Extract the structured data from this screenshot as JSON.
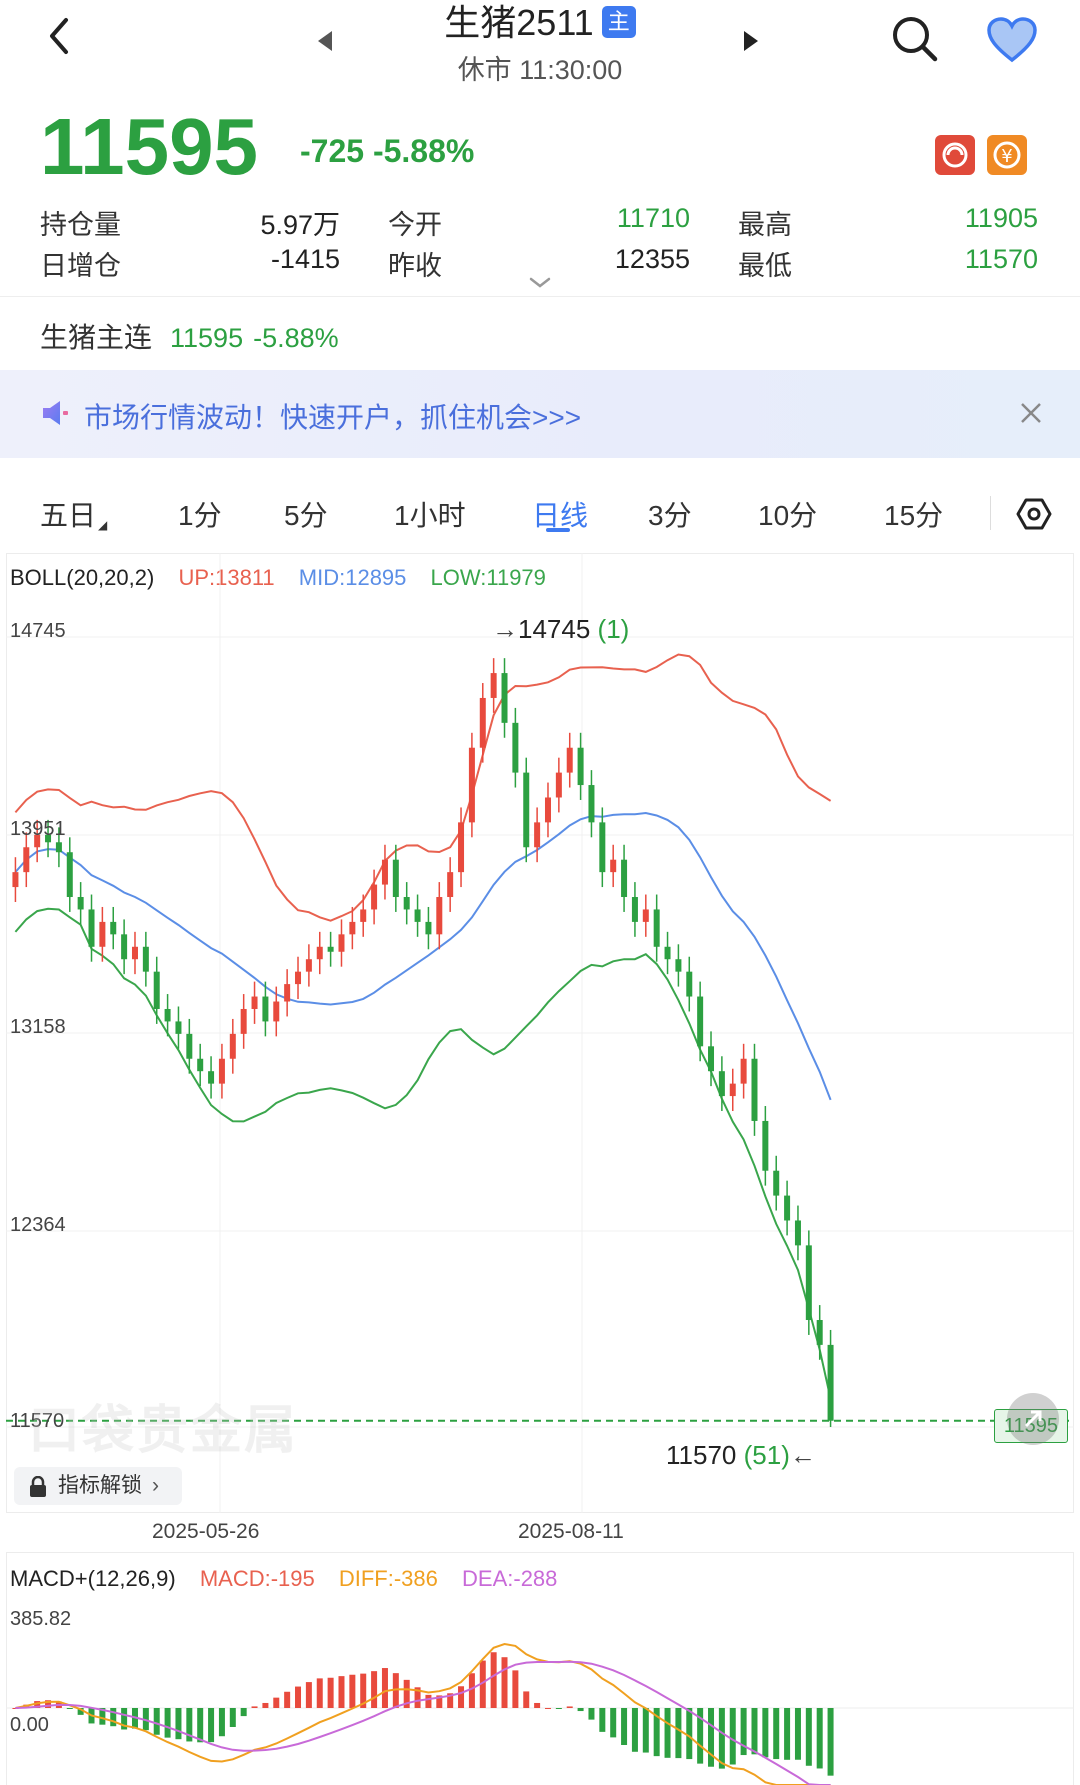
{
  "header": {
    "title": "生猪2511",
    "badge": "主",
    "status": "休市 11:30:00"
  },
  "quote": {
    "price": "11595",
    "change": "-725",
    "change_pct": "-5.88%",
    "fields": [
      {
        "label": "持仓量",
        "value": "5.97万"
      },
      {
        "label": "今开",
        "value": "11710"
      },
      {
        "label": "最高",
        "value": "11905"
      },
      {
        "label": "日增仓",
        "value": "-1415"
      },
      {
        "label": "昨收",
        "value": "12355"
      },
      {
        "label": "最低",
        "value": "11570"
      }
    ]
  },
  "main_contract": {
    "label": "生猪主连",
    "price": "11595",
    "pct": "-5.88%"
  },
  "banner": {
    "text": "市场行情波动！快速开户，抓住机会>>>"
  },
  "tabs": [
    {
      "label": "五日",
      "active": false
    },
    {
      "label": "1分",
      "active": false
    },
    {
      "label": "5分",
      "active": false
    },
    {
      "label": "1小时",
      "active": false
    },
    {
      "label": "日线",
      "active": true
    },
    {
      "label": "3分",
      "active": false
    },
    {
      "label": "10分",
      "active": false
    },
    {
      "label": "15分",
      "active": false
    }
  ],
  "boll": {
    "name": "BOLL(20,20,2)",
    "up": "UP:13811",
    "mid": "MID:12895",
    "low": "LOW:11979"
  },
  "y_ticks": [
    "14745",
    "13951",
    "13158",
    "12364",
    "11570"
  ],
  "annotations": {
    "high": "14745",
    "high_idx": "(1)",
    "low": "11570",
    "low_idx": "(51)",
    "last_price_tag": "11595"
  },
  "watermark": "口袋贵金属",
  "lock_button": "指标解锁",
  "dates": [
    "2025-05-26",
    "2025-08-11"
  ],
  "macd": {
    "name": "MACD+(12,26,9)",
    "macd": "MACD:-195",
    "diff": "DIFF:-386",
    "dea": "DEA:-288",
    "y_top": "385.82",
    "y_zero": "0.00"
  },
  "colors": {
    "up": "#e84a3d",
    "down": "#2ca041",
    "boll_up": "#e8614f",
    "boll_mid": "#5b8ee6",
    "boll_low": "#3aa64c",
    "diff": "#f0a020",
    "dea": "#c86ad8"
  },
  "chart_data": {
    "type": "candlestick",
    "closes": [
      13800,
      13900,
      13950,
      13920,
      13880,
      13700,
      13650,
      13500,
      13600,
      13550,
      13450,
      13500,
      13400,
      13250,
      13200,
      13150,
      13050,
      13000,
      12950,
      13050,
      13150,
      13250,
      13300,
      13200,
      13280,
      13350,
      13400,
      13450,
      13500,
      13480,
      13550,
      13600,
      13650,
      13750,
      13850,
      13700,
      13650,
      13600,
      13550,
      13700,
      13800,
      14000,
      14300,
      14500,
      14600,
      14400,
      14200,
      13900,
      14000,
      14100,
      14200,
      14300,
      14150,
      14000,
      13800,
      13850,
      13700,
      13600,
      13650,
      13500,
      13450,
      13400,
      13300,
      13100,
      13000,
      12900,
      12950,
      13050,
      12800,
      12600,
      12500,
      12400,
      12300,
      12000,
      11900,
      11595
    ]
  }
}
